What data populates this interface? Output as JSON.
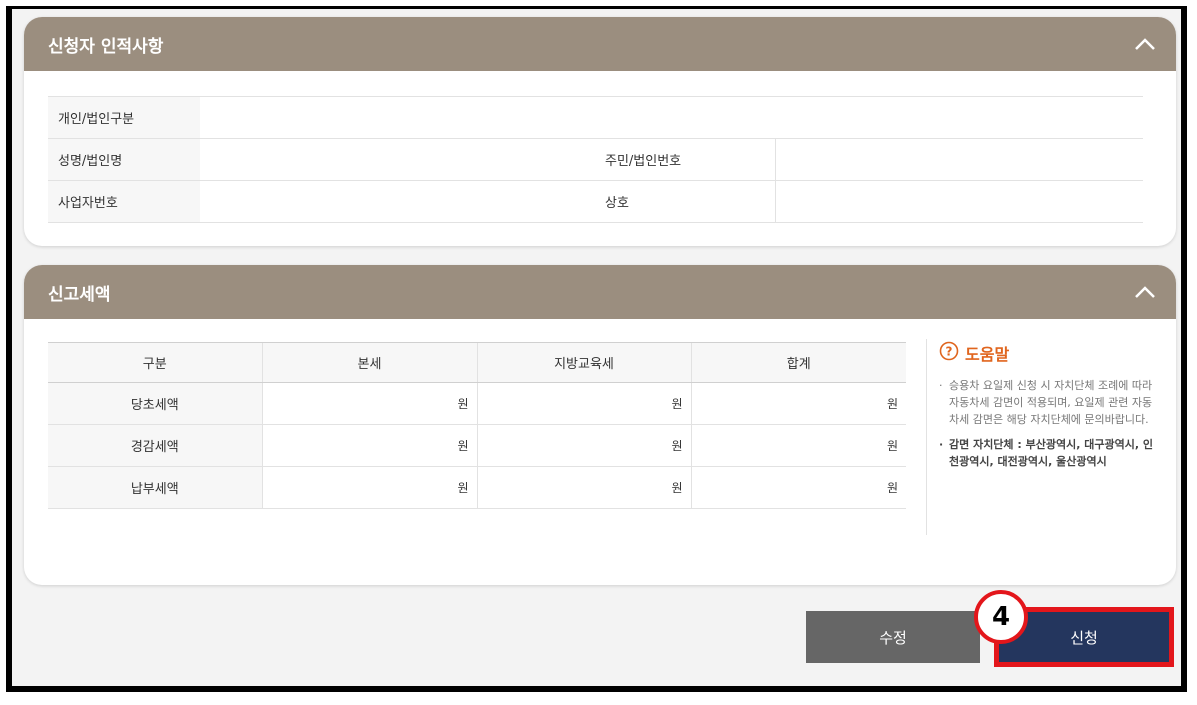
{
  "applicant": {
    "title": "신청자 인적사항",
    "rows": [
      {
        "label1": "개인/법인구분",
        "value1": ""
      },
      {
        "label1": "성명/법인명",
        "value1": "",
        "label2": "주민/법인번호",
        "value2": ""
      },
      {
        "label1": "사업자번호",
        "value1": "",
        "label2": "상호",
        "value2": ""
      }
    ]
  },
  "tax": {
    "title": "신고세액",
    "headers": [
      "구분",
      "본세",
      "지방교육세",
      "합계"
    ],
    "unit": "원",
    "rows": [
      {
        "label": "당초세액"
      },
      {
        "label": "경감세액"
      },
      {
        "label": "납부세액"
      }
    ]
  },
  "help": {
    "title": "도움말",
    "text1": "승용차 요일제 신청 시 자치단체 조례에 따라 자동차세 감면이 적용되며, 요일제 관련 자동차세 감면은 해당 자치단체에 문의바랍니다.",
    "text2": "감면 자치단체 : 부산광역시, 대구광역시, 인천광역시, 대전광역시, 울산광역시",
    "icon": "question-circle-icon",
    "accent": "#e0651e"
  },
  "buttons": {
    "edit": "수정",
    "apply": "신청"
  },
  "step_badge": "4",
  "colors": {
    "header": "#9b8e7f",
    "apply": "#24365e",
    "edit": "#666666",
    "highlight": "#e3161b"
  }
}
